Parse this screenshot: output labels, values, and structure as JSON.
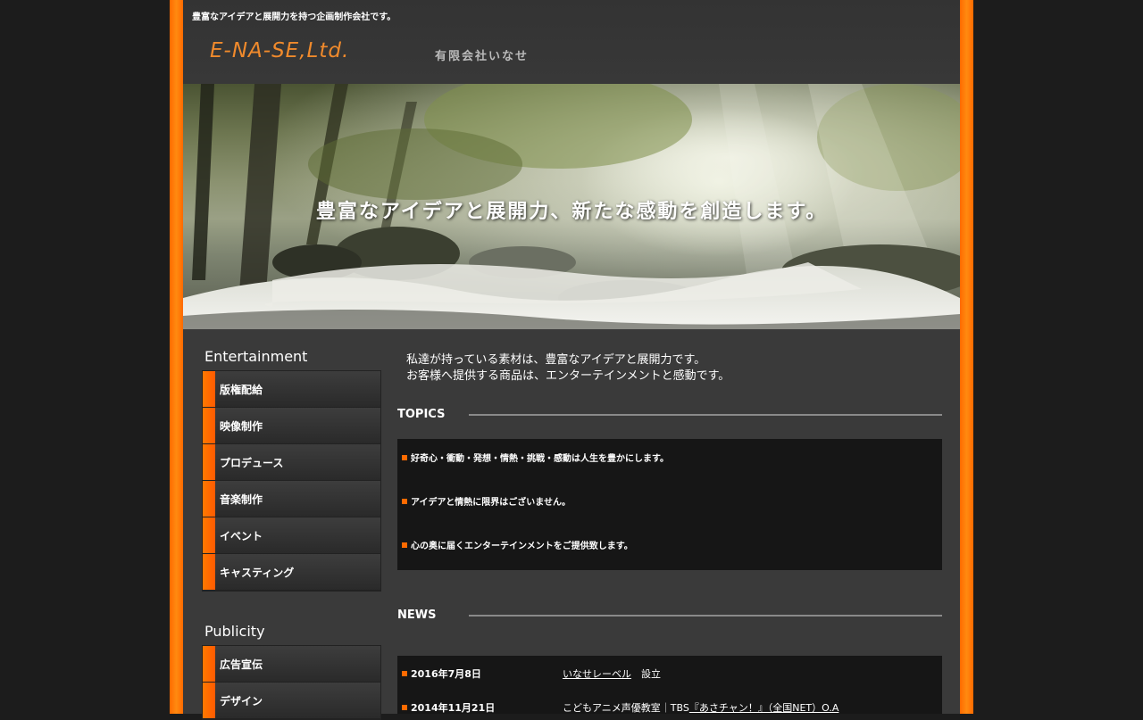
{
  "header": {
    "tagline": "豊富なアイデアと展開力を持つ企画制作会社です。",
    "logo": "E-NA-SE,Ltd.",
    "company_name": "有限会社いなせ"
  },
  "hero": {
    "headline": "豊富なアイデアと展開力、新たな感動を創造します。"
  },
  "sidebar": {
    "entertainment": {
      "title": "Entertainment",
      "items": [
        {
          "label": "版権配給"
        },
        {
          "label": "映像制作"
        },
        {
          "label": "プロデュース"
        },
        {
          "label": "音楽制作"
        },
        {
          "label": "イベント"
        },
        {
          "label": "キャスティング"
        }
      ]
    },
    "publicity": {
      "title": "Publicity",
      "items": [
        {
          "label": "広告宣伝"
        },
        {
          "label": "デザイン"
        }
      ]
    }
  },
  "intro": {
    "line1": "私達が持っている素材は、豊富なアイデアと展開力です。",
    "line2": "お客様へ提供する商品は、エンターテインメントと感動です。"
  },
  "topics": {
    "title": "TOPICS",
    "items": [
      "好奇心・衝動・発想・情熱・挑戦・感動は人生を豊かにします。",
      "アイデアと情熱に限界はございません。",
      "心の奥に届くエンターテインメントをご提供致します。"
    ]
  },
  "news": {
    "title": "NEWS",
    "items": [
      {
        "date": "2016年7月8日",
        "link": "いなせレーベル",
        "suffix": "　設立"
      },
      {
        "date": "2014年11月21日",
        "prefix": "こどもアニメ声優教室｜TBS",
        "link": "『あさチャン！』（全国NET）O.A"
      }
    ]
  },
  "colors": {
    "accent": "#ff6a00",
    "logo": "#f08a2c",
    "page_bg": "#3a3a3a",
    "outer_bg": "#1c1c1c"
  }
}
